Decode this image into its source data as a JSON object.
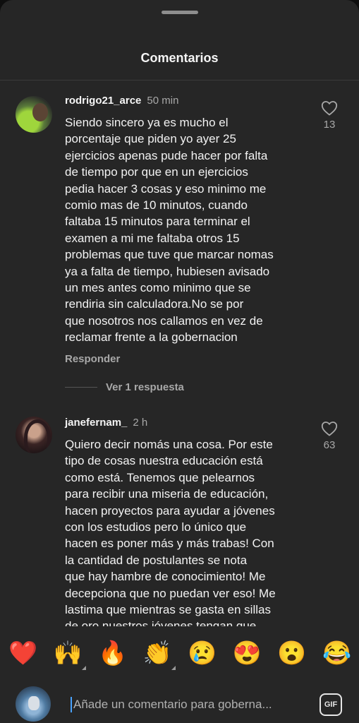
{
  "sheet": {
    "title": "Comentarios"
  },
  "comments": [
    {
      "username": "rodrigo21_arce",
      "time": "50 min",
      "text": "Siendo sincero ya es mucho el\nporcentaje que piden yo ayer 25\nejercicios apenas pude hacer por falta\nde tiempo por que en un ejercicios\npedia hacer 3 cosas y eso minimo me\ncomio mas de 10 minutos, cuando\nfaltaba 15 minutos para terminar el\nexamen a mi me faltaba otros 15\nproblemas que tuve que marcar nomas\nya a falta de tiempo, hubiesen avisado\nun mes antes como minimo que se\nrendiria sin calculadora.No se por\nque nosotros nos callamos en vez de\nreclamar frente a la gobernacion",
      "likes": "13",
      "reply_label": "Responder",
      "view_replies_label": "Ver 1 respuesta"
    },
    {
      "username": "janefernam_",
      "time": "2 h",
      "text": "Quiero decir nomás una cosa. Por este\ntipo de cosas nuestra educación está\ncomo está. Tenemos que pelearnos\npara recibir una miseria de educación,\nhacen proyectos para ayudar a jóvenes\ncon los estudios pero lo único que\nhacen es poner más y más trabas! Con\nla cantidad de postulantes se nota\nque hay hambre de conocimiento! Me\ndecepciona que no puedan ver eso! Me\nlastima que mientras se gasta en sillas\nde oro nuestros jóvenes tengan que",
      "likes": "63"
    }
  ],
  "emoji_bar": [
    {
      "emoji": "❤️",
      "name": "red-heart"
    },
    {
      "emoji": "🙌",
      "name": "raising-hands"
    },
    {
      "emoji": "🔥",
      "name": "fire"
    },
    {
      "emoji": "👏",
      "name": "clapping-hands"
    },
    {
      "emoji": "😢",
      "name": "crying-face"
    },
    {
      "emoji": "😍",
      "name": "heart-eyes"
    },
    {
      "emoji": "😮",
      "name": "surprised-face"
    },
    {
      "emoji": "😂",
      "name": "tears-of-joy"
    }
  ],
  "compose": {
    "placeholder": "Añade un comentario para goberna...",
    "gif_label": "GIF"
  },
  "colors": {
    "sheet_bg": "#262626",
    "text_primary": "#f5f5f5",
    "text_secondary": "#a8a8a8"
  }
}
